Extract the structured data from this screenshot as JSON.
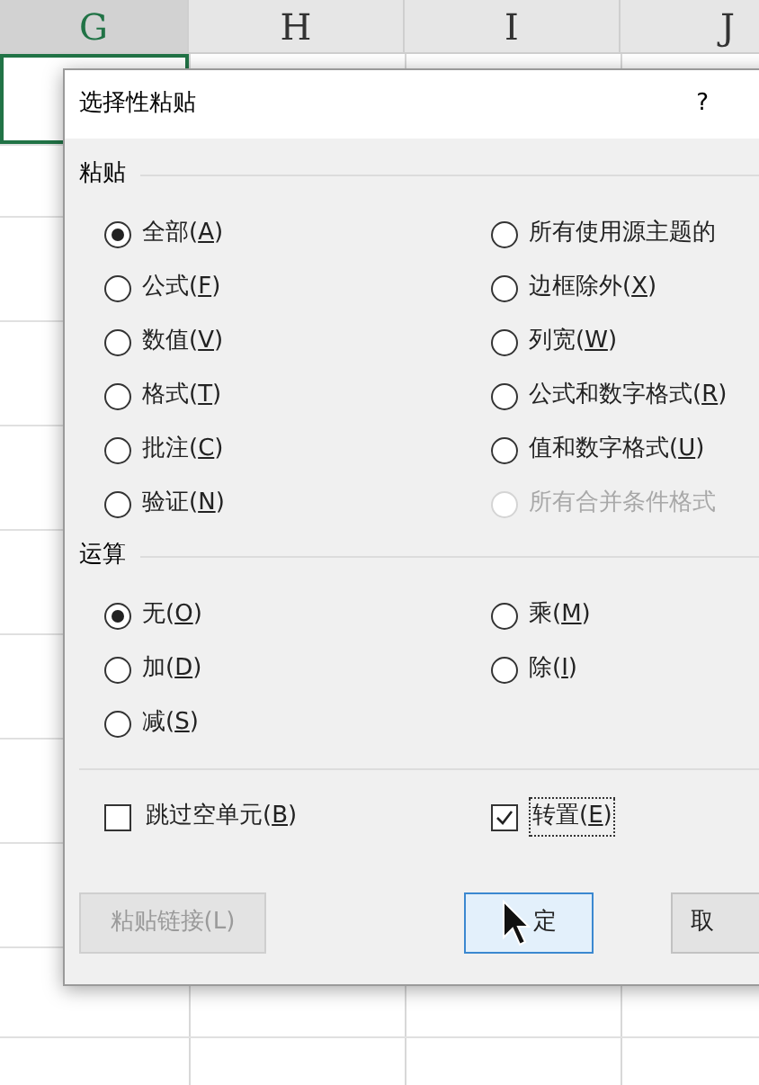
{
  "sheet": {
    "columns": [
      {
        "label": "G",
        "selected": true
      },
      {
        "label": "H",
        "selected": false
      },
      {
        "label": "I",
        "selected": false
      },
      {
        "label": "J",
        "selected": false
      }
    ]
  },
  "dialog": {
    "title": "选择性粘贴",
    "help": "?",
    "paste": {
      "heading": "粘贴",
      "options": [
        {
          "prefix": "全部(",
          "key": "A",
          "suffix": ")",
          "selected": true,
          "disabled": false
        },
        {
          "prefix": "所有使用源主题的",
          "selected": false,
          "disabled": false
        },
        {
          "prefix": "公式(",
          "key": "F",
          "suffix": ")",
          "selected": false,
          "disabled": false
        },
        {
          "prefix": "边框除外(",
          "key": "X",
          "suffix": ")",
          "selected": false,
          "disabled": false
        },
        {
          "prefix": "数值(",
          "key": "V",
          "suffix": ")",
          "selected": false,
          "disabled": false
        },
        {
          "prefix": "列宽(",
          "key": "W",
          "suffix": ")",
          "selected": false,
          "disabled": false
        },
        {
          "prefix": "格式(",
          "key": "T",
          "suffix": ")",
          "selected": false,
          "disabled": false
        },
        {
          "prefix": "公式和数字格式(",
          "key": "R",
          "suffix": ")",
          "selected": false,
          "disabled": false
        },
        {
          "prefix": "批注(",
          "key": "C",
          "suffix": ")",
          "selected": false,
          "disabled": false
        },
        {
          "prefix": "值和数字格式(",
          "key": "U",
          "suffix": ")",
          "selected": false,
          "disabled": false
        },
        {
          "prefix": "验证(",
          "key": "N",
          "suffix": ")",
          "selected": false,
          "disabled": false
        },
        {
          "prefix": "所有合并条件格式",
          "selected": false,
          "disabled": true
        }
      ]
    },
    "operation": {
      "heading": "运算",
      "options": [
        {
          "prefix": "无(",
          "key": "O",
          "suffix": ")",
          "selected": true,
          "disabled": false
        },
        {
          "prefix": "乘(",
          "key": "M",
          "suffix": ")",
          "selected": false,
          "disabled": false
        },
        {
          "prefix": "加(",
          "key": "D",
          "suffix": ")",
          "selected": false,
          "disabled": false
        },
        {
          "prefix": "除(",
          "key": "I",
          "suffix": ")",
          "selected": false,
          "disabled": false
        },
        {
          "prefix": "减(",
          "key": "S",
          "suffix": ")",
          "selected": false,
          "disabled": false
        }
      ]
    },
    "checkboxes": [
      {
        "prefix": "跳过空单元(",
        "key": "B",
        "suffix": ")",
        "checked": false,
        "focused": false
      },
      {
        "prefix": "转置(",
        "key": "E",
        "suffix": ")",
        "checked": true,
        "focused": true
      }
    ],
    "buttons": [
      {
        "label": "粘贴链接(L)",
        "disabled": true,
        "default": false
      },
      {
        "label": "定",
        "disabled": false,
        "default": true
      },
      {
        "label": "取",
        "disabled": false,
        "default": false
      }
    ]
  }
}
